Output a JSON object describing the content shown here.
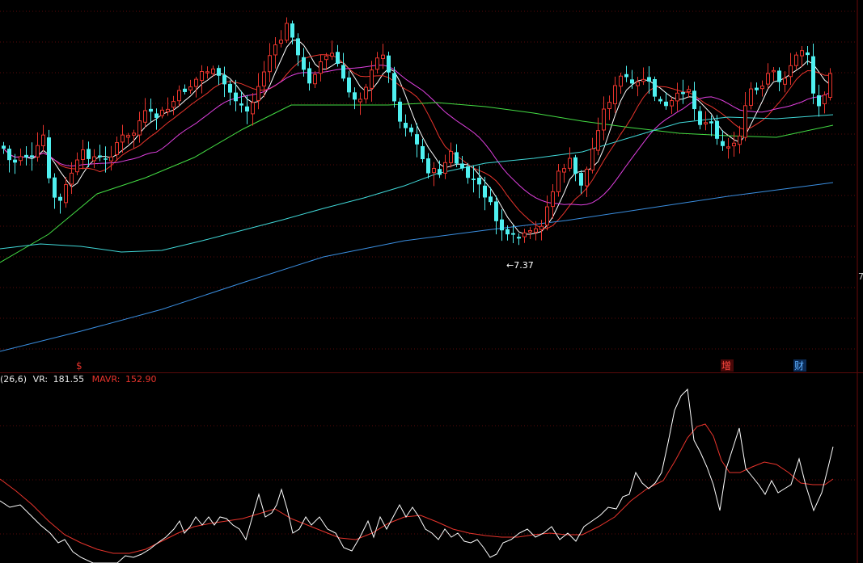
{
  "chart_data": [
    {
      "type": "candlestick",
      "panel": "price",
      "low_marker": "←7.37",
      "right_axis_label": "7",
      "event_markers": [
        {
          "label": "$",
          "color": "#e0302a"
        },
        {
          "label": "增",
          "color": "#e0302a"
        },
        {
          "label": "财",
          "color": "#4aa3ff"
        }
      ],
      "colors": {
        "up": "#e8342c",
        "down": "#4ff0f0",
        "ma5": "#ffffff",
        "ma10": "#e8342c",
        "ma20": "#e040e0",
        "ma60": "#44dd44",
        "ma120": "#40d8d8",
        "ma250": "#3a8ee0"
      },
      "grid": "dashed"
    },
    {
      "type": "line",
      "panel": "indicator",
      "params": "(26,6)",
      "series": [
        {
          "name": "VR",
          "value_label": "181.55",
          "color": "#ffffff"
        },
        {
          "name": "MAVR",
          "value_label": "152.90",
          "color": "#e8342c"
        }
      ]
    }
  ],
  "indicator_header": {
    "params": "(26,6)",
    "vr_label": "VR:",
    "vr_value": "181.55",
    "mavr_label": "MAVR:",
    "mavr_value": "152.90"
  }
}
